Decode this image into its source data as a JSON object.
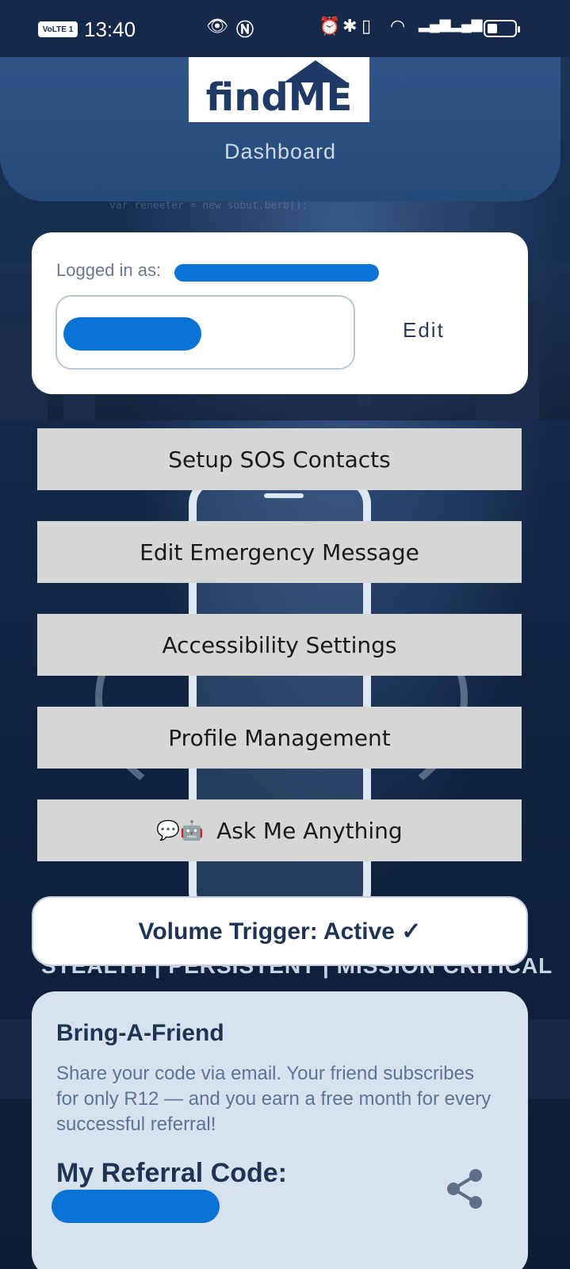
{
  "status_bar": {
    "network_badge": "VoLTE 1",
    "time": "13:40"
  },
  "header": {
    "logo_text": "findME",
    "title": "Dashboard"
  },
  "login": {
    "label": "Logged in as:",
    "edit_label": "Edit"
  },
  "menu": {
    "items": [
      {
        "label": "Setup SOS Contacts"
      },
      {
        "label": "Edit Emergency Message"
      },
      {
        "label": "Accessibility Settings"
      },
      {
        "label": "Profile Management"
      },
      {
        "label": "Ask Me Anything",
        "emoji": "💬🤖"
      }
    ]
  },
  "volume_trigger": {
    "label": "Volume Trigger: Active ✓"
  },
  "background": {
    "tagline": "STEALTH | PERSISTENT | MISSION CRITICAL",
    "code_snippet": "var reneeter = new sobut.berb();"
  },
  "referral": {
    "title": "Bring-A-Friend",
    "description": "Share your code via email. Your friend subscribes for only R12 — and you earn a free month for every successful referral!",
    "code_label": "My Referral Code:"
  },
  "colors": {
    "header_blue": "#264a7a",
    "redaction_blue": "#0a74d6",
    "button_grey": "#d6d6d6",
    "card_light_blue": "#d6e2ee"
  }
}
